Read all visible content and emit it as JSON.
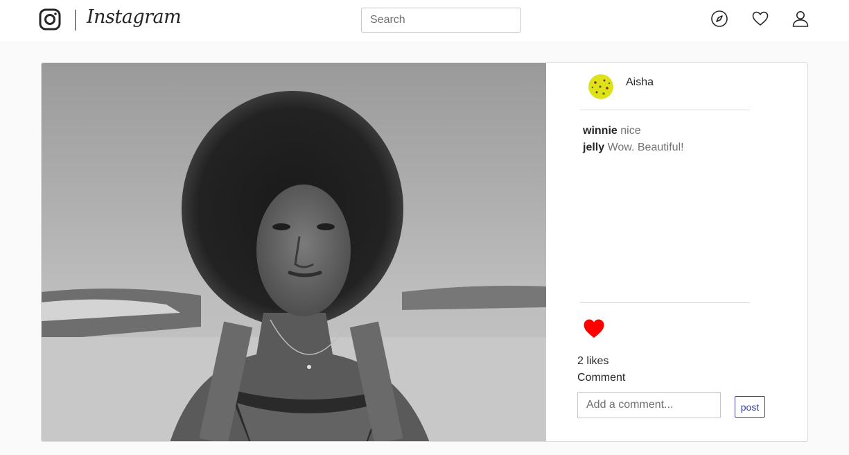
{
  "header": {
    "brand": "Instagram",
    "search": {
      "placeholder": "Search",
      "value": ""
    },
    "nav_icons": [
      "compass-icon",
      "heart-icon",
      "user-icon"
    ]
  },
  "post": {
    "author": "Aisha",
    "comments": [
      {
        "author": "winnie",
        "text": "nice"
      },
      {
        "author": "jelly",
        "text": "Wow. Beautiful!"
      }
    ],
    "liked": true,
    "likes_text": "2 likes",
    "comment_label": "Comment",
    "comment_input": {
      "placeholder": "Add a comment...",
      "value": ""
    },
    "post_button": "post"
  },
  "colors": {
    "like_red": "#ff0000",
    "post_button_blue": "#3b3fb0",
    "avatar_yellow": "#dde21a"
  }
}
